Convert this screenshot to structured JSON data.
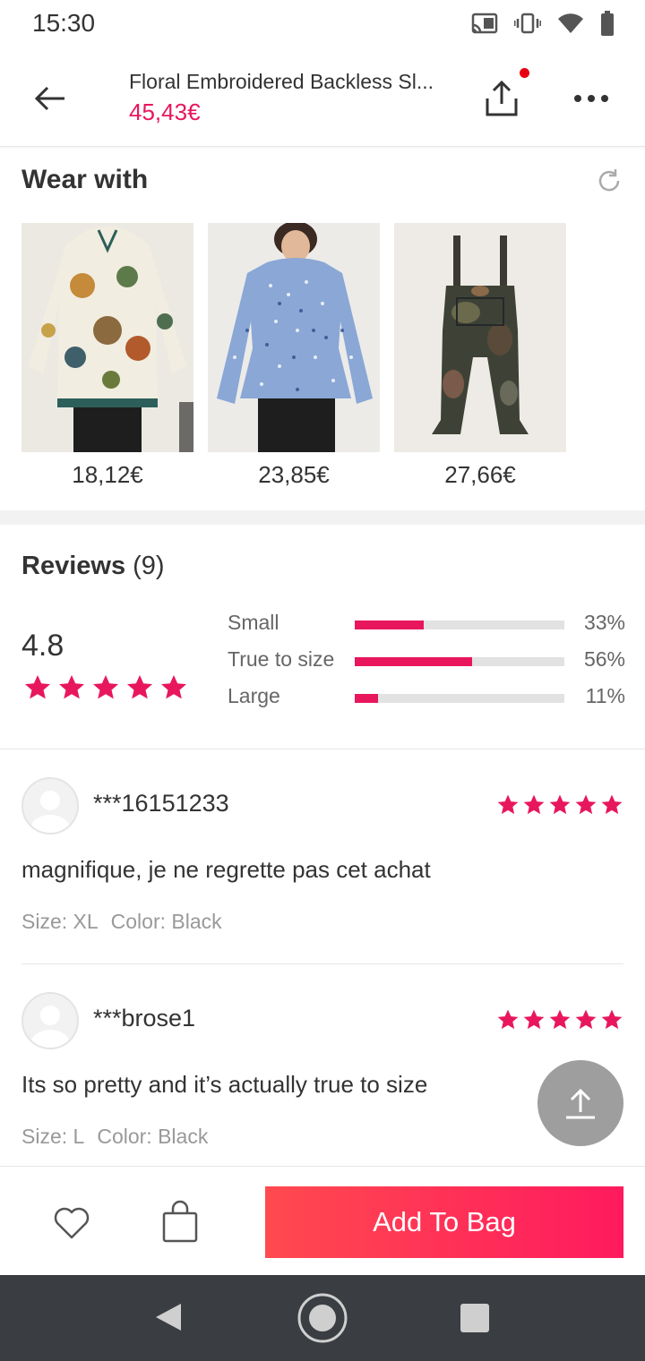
{
  "status_bar": {
    "time": "15:30",
    "icons": [
      "cast-icon",
      "vibrate-icon",
      "wifi-icon",
      "battery-icon"
    ]
  },
  "header": {
    "title": "Floral Embroidered Backless Sl...",
    "price": "45,43€",
    "back_icon": "arrow-left-icon",
    "share_icon": "share-icon",
    "more_icon": "more-dots-icon"
  },
  "wear_with": {
    "title": "Wear with",
    "refresh_icon": "refresh-icon",
    "items": [
      {
        "price": "18,12€"
      },
      {
        "price": "23,85€"
      },
      {
        "price": "27,66€"
      }
    ]
  },
  "reviews": {
    "title": "Reviews",
    "count": "(9)",
    "rating": "4.8",
    "rating_stars": 5,
    "fit": [
      {
        "label": "Small",
        "percent_text": "33%",
        "percent": 33
      },
      {
        "label": "True to size",
        "percent_text": "56%",
        "percent": 56
      },
      {
        "label": "Large",
        "percent_text": "11%",
        "percent": 11
      }
    ],
    "items": [
      {
        "user": "***16151233",
        "stars": 5,
        "text": "magnifique, je ne regrette pas cet achat",
        "size": "Size: XL",
        "color": "Color: Black"
      },
      {
        "user": "***brose1",
        "stars": 5,
        "text": "Its so pretty and it’s actually true to size",
        "size": "Size: L",
        "color": "Color: Black"
      }
    ]
  },
  "bottom_bar": {
    "add_to_bag": "Add To Bag",
    "wishlist_icon": "heart-icon",
    "bag_icon": "bag-icon"
  },
  "colors": {
    "accent": "#e8175d",
    "button_gradient_start": "#ff4a4f",
    "button_gradient_end": "#ff1a5e",
    "nav_bar": "#3a3d42"
  }
}
